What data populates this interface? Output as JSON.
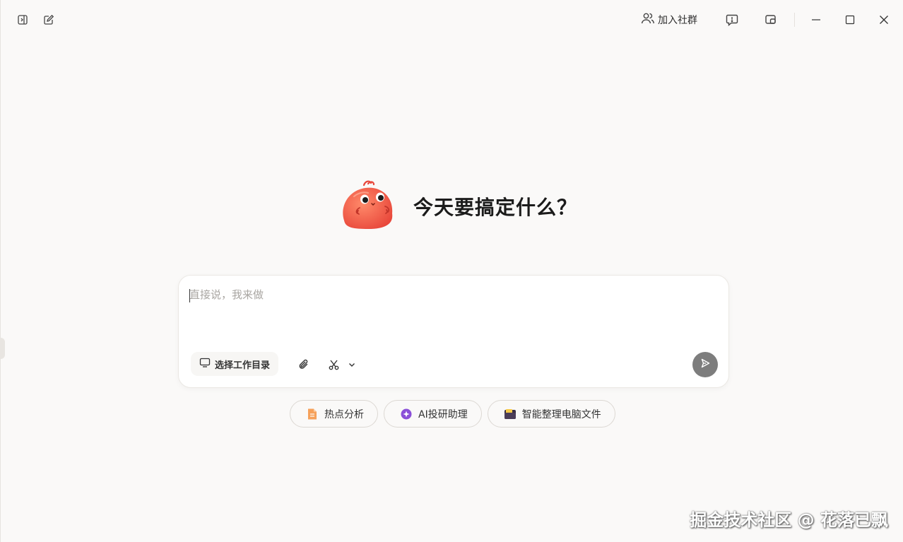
{
  "titlebar": {
    "sidebar_toggle_icon": "sidebar-toggle-icon",
    "new_chat_icon": "edit-icon",
    "community_label": "加入社群",
    "feedback_icon": "feedback-icon",
    "window_icon": "picture-in-picture-icon"
  },
  "hero": {
    "title": "今天要搞定什么？"
  },
  "composer": {
    "placeholder": "直接说，我来做",
    "workdir_label": "选择工作目录",
    "attach_icon": "paperclip-icon",
    "tools_icon": "scissors-icon",
    "send_icon": "send-icon"
  },
  "suggestions": [
    {
      "label": "热点分析",
      "icon": "document-orange-icon"
    },
    {
      "label": "AI投研助理",
      "icon": "sparkle-purple-icon"
    },
    {
      "label": "智能整理电脑文件",
      "icon": "folder-icon"
    }
  ],
  "watermark": "掘金技术社区 @ 花落已飘",
  "colors": {
    "background": "#faf9f8",
    "mascot": "#f0624a",
    "send_button": "#7d7d7d"
  }
}
